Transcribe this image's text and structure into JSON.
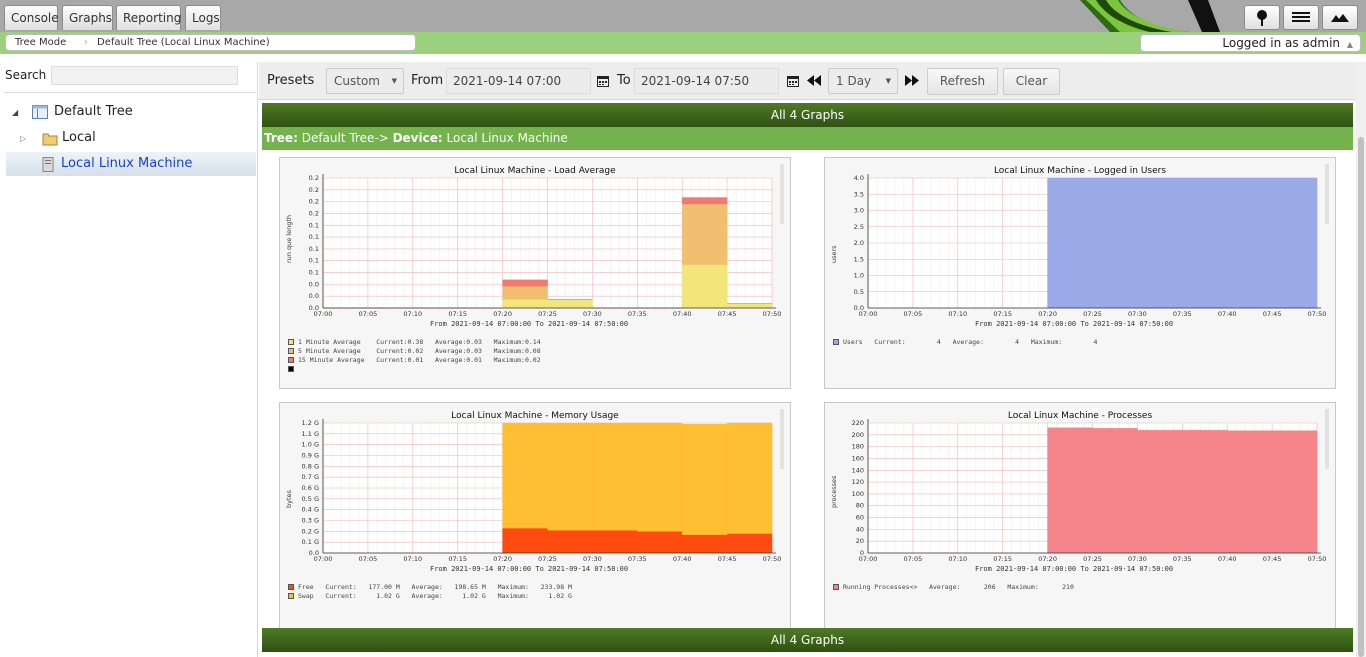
{
  "tabs": [
    {
      "label": "Console",
      "active": false
    },
    {
      "label": "Graphs",
      "active": true
    },
    {
      "label": "Reporting",
      "active": false
    },
    {
      "label": "Logs",
      "active": false
    }
  ],
  "breadcrumb": {
    "mode": "Tree Mode",
    "current": "Default Tree (Local Linux Machine)"
  },
  "user": {
    "status": "Logged in as admin",
    "caret": "▲"
  },
  "sidebar": {
    "search_label": "Search",
    "search_value": "",
    "tree": [
      {
        "label": "Default Tree",
        "expander": "◢"
      },
      {
        "label": "Local",
        "expander": "▷"
      },
      {
        "label": "Local Linux Machine",
        "selected": true
      }
    ]
  },
  "filters": {
    "presets_label": "Presets",
    "preset_value": "Custom",
    "from_label": "From",
    "from_value": "2021-09-14 07:00",
    "to_label": "To",
    "to_value": "2021-09-14 07:50",
    "timespan_value": "1 Day",
    "refresh_label": "Refresh",
    "clear_label": "Clear"
  },
  "header": {
    "all_graphs": "All 4 Graphs",
    "footer_all_graphs": "All 4 Graphs"
  },
  "tree_path": {
    "tree_label": "Tree:",
    "tree_value": "Default Tree->",
    "device_label": "Device:",
    "device_value": "Local Linux Machine"
  },
  "graph_common": {
    "x_ticks": [
      "07:00",
      "07:05",
      "07:10",
      "07:15",
      "07:20",
      "07:25",
      "07:30",
      "07:35",
      "07:40",
      "07:45",
      "07:50"
    ],
    "from_text": "From 2021-09-14 07:00:00 To 2021-09-14 07:50:00"
  },
  "chart_data": [
    {
      "type": "area",
      "title": "Local Linux Machine - Load Average",
      "ylabel": "run que length",
      "ylim": [
        0,
        0.3
      ],
      "y_ticks": [
        "0.0",
        "0.0",
        "0.0",
        "0.1",
        "0.1",
        "0.1",
        "0.1",
        "0.1",
        "0.2",
        "0.2",
        "0.2",
        "0.2"
      ],
      "x": [
        "07:00",
        "07:05",
        "07:10",
        "07:15",
        "07:20",
        "07:25",
        "07:30",
        "07:35",
        "07:40",
        "07:45",
        "07:50"
      ],
      "series": [
        {
          "name": "1 Minute Average",
          "color": "#f2e67a",
          "values": [
            0,
            0,
            0,
            0,
            0.02,
            0.02,
            0.0,
            0,
            0.1,
            0.01,
            0
          ]
        },
        {
          "name": "5 Minute Average",
          "color": "#f0c070",
          "values": [
            0,
            0,
            0,
            0,
            0.03,
            0.0,
            0.0,
            0,
            0.14,
            0.0,
            0
          ]
        },
        {
          "name": "15 Minute Average",
          "color": "#f07a70",
          "values": [
            0,
            0,
            0,
            0,
            0.015,
            0,
            0,
            0,
            0.015,
            0,
            0
          ]
        }
      ],
      "legend": [
        {
          "color": "#f2e67a",
          "text": "1 Minute Average    Current:0.38   Average:0.03   Maximum:0.14"
        },
        {
          "color": "#f0c070",
          "text": "5 Minute Average    Current:0.02   Average:0.03   Maximum:0.08"
        },
        {
          "color": "#f07a70",
          "text": "15 Minute Average   Current:0.01   Average:0.01   Maximum:0.02"
        },
        {
          "color": "#000000",
          "text": ""
        }
      ]
    },
    {
      "type": "area",
      "title": "Local Linux Machine - Logged in Users",
      "ylabel": "users",
      "ylim": [
        0,
        4.0
      ],
      "y_ticks": [
        "0.0",
        "0.5",
        "1.0",
        "1.5",
        "2.0",
        "2.5",
        "3.0",
        "3.5",
        "4.0"
      ],
      "x": [
        "07:00",
        "07:05",
        "07:10",
        "07:15",
        "07:20",
        "07:25",
        "07:30",
        "07:35",
        "07:40",
        "07:45",
        "07:50"
      ],
      "series": [
        {
          "name": "Users",
          "color": "#9aaae8",
          "values": [
            null,
            null,
            null,
            null,
            4,
            4,
            4,
            4,
            4,
            4,
            4
          ]
        }
      ],
      "legend": [
        {
          "color": "#9aaae8",
          "text": "Users   Current:        4   Average:        4   Maximum:        4"
        }
      ]
    },
    {
      "type": "area",
      "title": "Local Linux Machine - Memory Usage",
      "ylabel": "bytes",
      "ylim": [
        0,
        1.2
      ],
      "y_ticks": [
        "0.0",
        "0.1 G",
        "0.2 G",
        "0.3 G",
        "0.4 G",
        "0.5 G",
        "0.6 G",
        "0.7 G",
        "0.8 G",
        "0.9 G",
        "1.0 G",
        "1.1 G",
        "1.2 G"
      ],
      "x": [
        "07:00",
        "07:05",
        "07:10",
        "07:15",
        "07:20",
        "07:25",
        "07:30",
        "07:35",
        "07:40",
        "07:45",
        "07:50"
      ],
      "series": [
        {
          "name": "Free",
          "color": "#ff4a10",
          "values": [
            null,
            null,
            null,
            null,
            0.23,
            0.21,
            0.21,
            0.2,
            0.17,
            0.18,
            0.18
          ]
        },
        {
          "name": "Swap",
          "color": "#ffbf33",
          "values": [
            null,
            null,
            null,
            null,
            1.02,
            1.02,
            1.01,
            1.02,
            1.02,
            1.03,
            1.02
          ]
        }
      ],
      "legend": [
        {
          "color": "#ff4a10",
          "text": "Free   Current:   177.00 M   Average:   198.65 M   Maximum:   233.98 M"
        },
        {
          "color": "#ffbf33",
          "text": "Swap   Current:     1.02 G   Average:     1.02 G   Maximum:     1.02 G"
        }
      ]
    },
    {
      "type": "area",
      "title": "Local Linux Machine - Processes",
      "ylabel": "processes",
      "ylim": [
        0,
        220
      ],
      "y_ticks": [
        "0",
        "20",
        "40",
        "60",
        "80",
        "100",
        "120",
        "140",
        "160",
        "180",
        "200",
        "220"
      ],
      "x": [
        "07:00",
        "07:05",
        "07:10",
        "07:15",
        "07:20",
        "07:25",
        "07:30",
        "07:35",
        "07:40",
        "07:45",
        "07:50"
      ],
      "series": [
        {
          "name": "Running Processes<>",
          "color": "#f5858a",
          "values": [
            null,
            null,
            null,
            null,
            212,
            211,
            208,
            208,
            207,
            207,
            206
          ]
        }
      ],
      "legend": [
        {
          "color": "#f5858a",
          "text": "Running Processes<>   Average:      206   Maximum:      210"
        }
      ]
    }
  ]
}
